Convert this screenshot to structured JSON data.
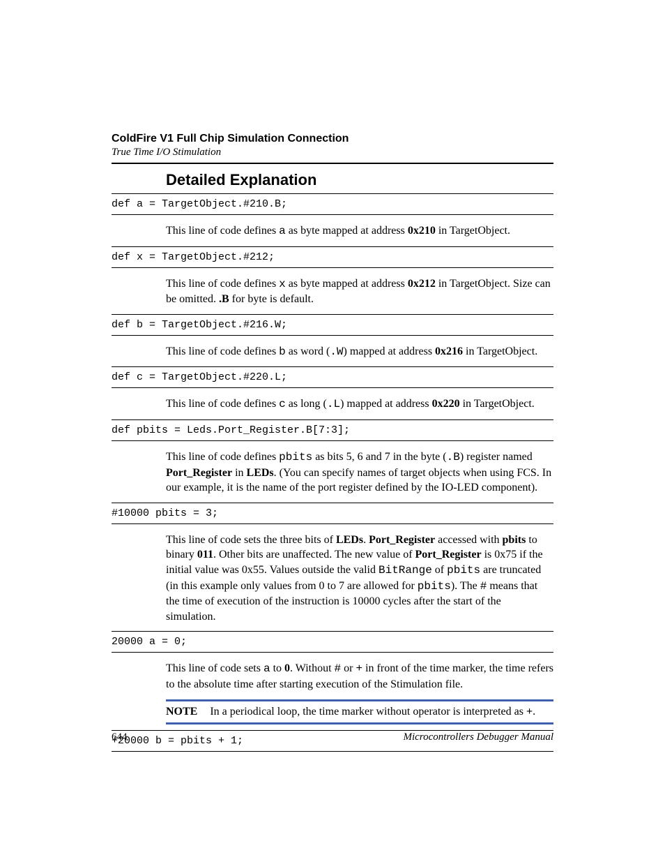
{
  "header": {
    "chapter": "ColdFire V1 Full Chip Simulation Connection",
    "section": "True Time I/O Stimulation"
  },
  "title": "Detailed Explanation",
  "blocks": [
    {
      "code": "def a = TargetObject.#210.B;",
      "explanation": "This line of code defines <span class=\"mono\">a</span> as byte mapped at address <b>0x210</b> in TargetObject."
    },
    {
      "code": "def x = TargetObject.#212;",
      "explanation": "This line of code defines <span class=\"mono\">x</span> as byte mapped at address <b>0x212</b> in TargetObject. Size can be omitted. <b>.B</b> for byte is default."
    },
    {
      "code": "def b = TargetObject.#216.W;",
      "explanation": "This line of code defines <span class=\"mono\">b</span> as word (<span class=\"mono\">.W</span>) mapped at address <b>0x216</b> in TargetObject."
    },
    {
      "code": "def c = TargetObject.#220.L;",
      "explanation": "This line of code defines <span class=\"mono\">c</span> as long (<span class=\"mono\">.L</span>) mapped at address <b>0x220</b> in TargetObject."
    },
    {
      "code": "def pbits = Leds.Port_Register.B[7:3];",
      "explanation": "This line of code defines <span class=\"mono\">pbits</span> as bits 5, 6 and 7 in the byte (<span class=\"mono\">.B</span>) register named <b>Port_Register</b> in <b>LEDs</b>. (You can specify names of target objects when using FCS. In our example, it is the name of the port register defined by the IO-LED component)."
    },
    {
      "code": "#10000 pbits = 3;",
      "explanation": "This line of code sets the three bits of <b>LEDs</b>. <b>Port_Register</b> accessed with <b>pbits</b> to binary <b>011</b>. Other bits are unaffected. The new value of <b>Port_Register</b> is 0x75 if the initial value was 0x55. Values outside the valid <span class=\"mono\">BitRange</span> of <span class=\"mono\">pbits</span> are truncated (in this example only values from 0 to 7 are allowed for <span class=\"mono\">pbits</span>). The <span class=\"mono\">#</span> means that the time of execution of the instruction is 10000 cycles after the start of the simulation."
    },
    {
      "code": "20000 a = 0;",
      "explanation": "This line of code sets <span class=\"mono\">a</span> to <b>0</b>. Without <span class=\"mono\">#</span> or <span class=\"mono\">+</span> in front of the time marker, the time refers to the absolute time after starting execution of the Stimulation file."
    }
  ],
  "note": {
    "label": "NOTE",
    "text": "In a periodical loop, the time marker without operator is interpreted as <b>+</b>."
  },
  "trailing_code": "+20000 b = pbits + 1;",
  "footer": {
    "page": "644",
    "manual": "Microcontrollers Debugger Manual"
  }
}
